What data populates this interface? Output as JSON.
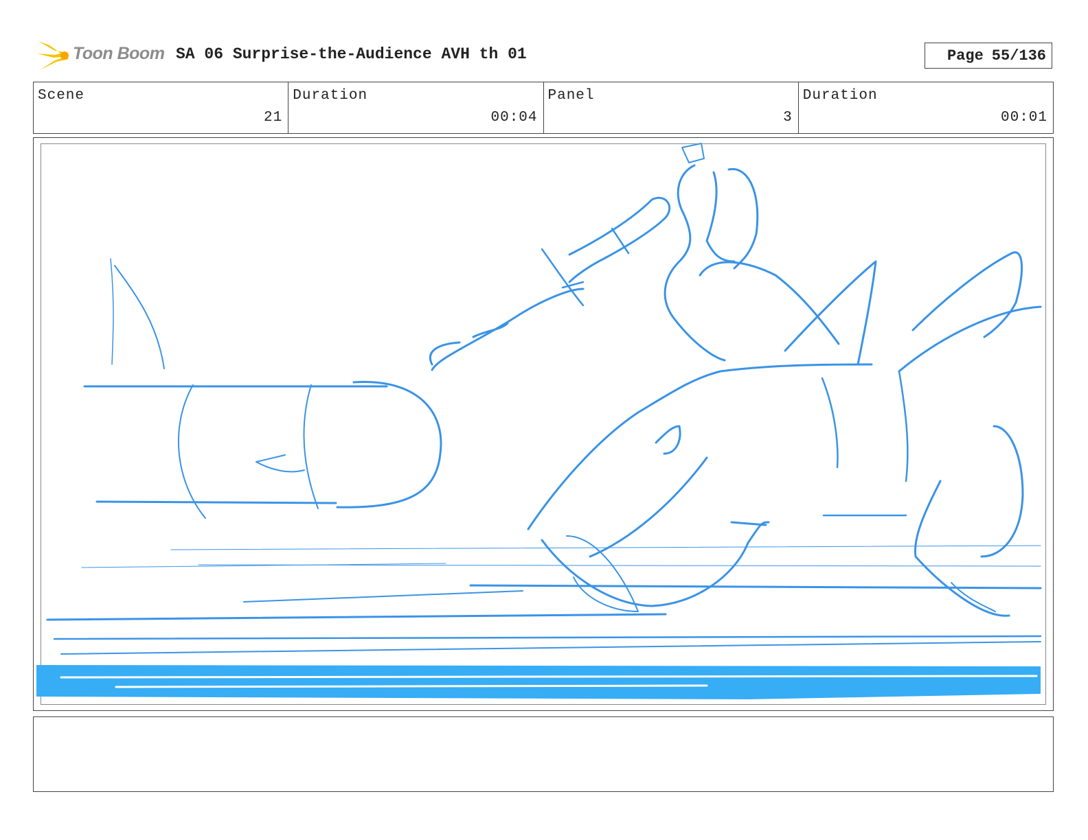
{
  "header": {
    "logo_text": "Toon Boom",
    "title": "SA 06 Surprise-the-Audience AVH th 01",
    "page_label": "Page",
    "page_value": "55/136"
  },
  "info": {
    "scene_label": "Scene",
    "scene_value": "21",
    "scene_duration_label": "Duration",
    "scene_duration_value": "00:04",
    "panel_label": "Panel",
    "panel_value": "3",
    "panel_duration_label": "Duration",
    "panel_duration_value": "00:01"
  },
  "notes": {
    "text": ""
  },
  "colors": {
    "sketch": "#3a93e6",
    "sketch_fill": "#36adf5",
    "logo_burst": "#f5c400",
    "logo_text": "#8c8c8c"
  }
}
